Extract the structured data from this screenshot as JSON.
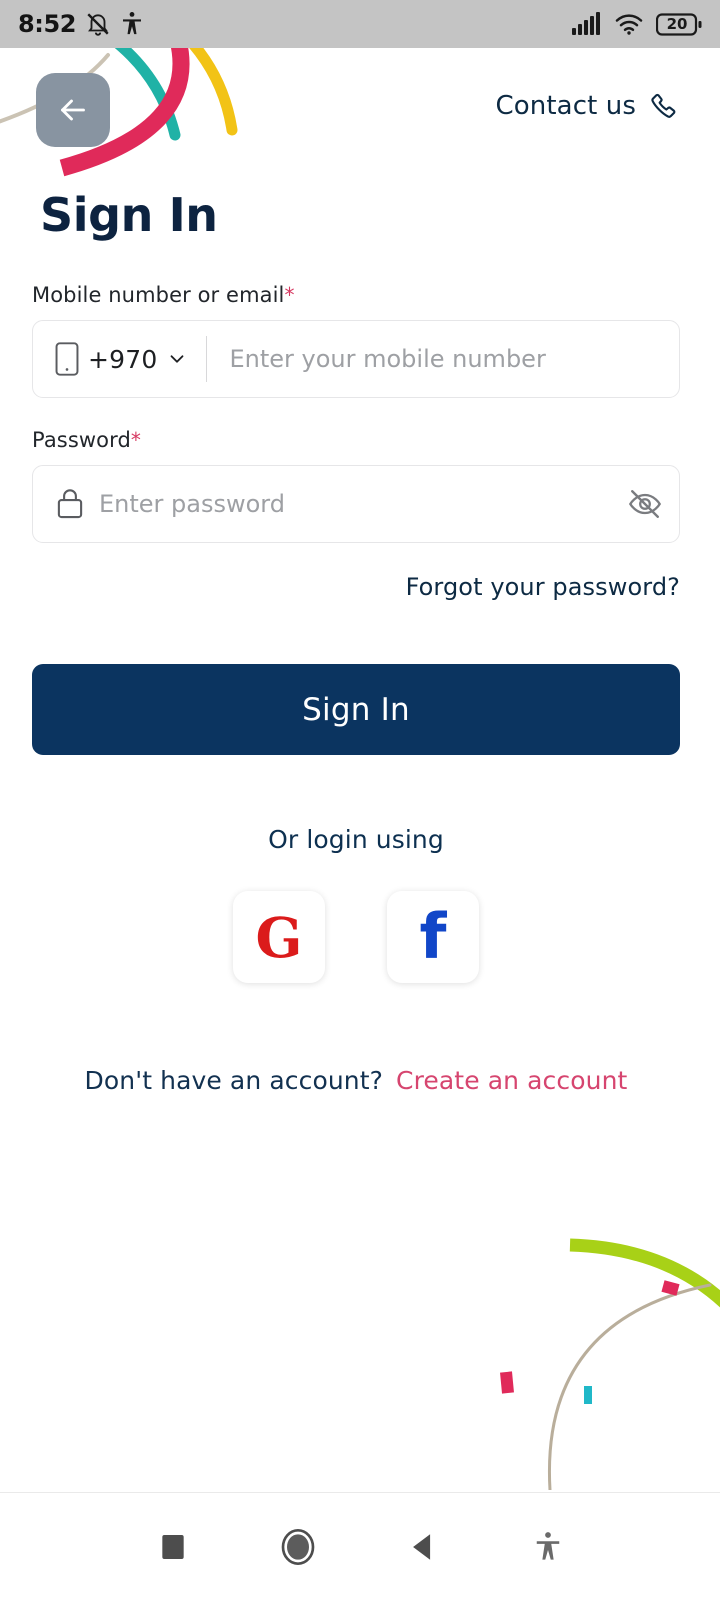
{
  "status_bar": {
    "time": "8:52",
    "battery_level": "20",
    "icons": [
      "notifications-muted-icon",
      "accessibility-icon",
      "cellular-signal-icon",
      "wifi-icon",
      "battery-icon"
    ]
  },
  "header": {
    "back_label": "back-arrow-icon",
    "contact_label": "Contact us",
    "contact_icon": "phone-icon"
  },
  "page": {
    "title": "Sign In"
  },
  "form": {
    "mobile": {
      "label": "Mobile number or email",
      "required_marker": "*",
      "country_code": "+970",
      "placeholder": "Enter your mobile number",
      "value": ""
    },
    "password": {
      "label": "Password",
      "required_marker": "*",
      "placeholder": "Enter password",
      "value": "",
      "visibility_icon": "eye-off-icon"
    },
    "forgot_password": "Forgot your password?",
    "submit_label": "Sign In"
  },
  "social": {
    "divider_text": "Or login using",
    "google_label": "G",
    "facebook_label": "f"
  },
  "signup": {
    "question": "Don't have an account?",
    "link": "Create an account"
  },
  "nav_bar": {
    "recents": "recent-apps-icon",
    "home": "home-icon",
    "back": "back-triangle-icon",
    "accessibility": "accessibility-icon"
  },
  "colors": {
    "primary_navy": "#0b3460",
    "title_navy": "#0d2340",
    "accent_pink": "#d6456f",
    "required_red": "#d63a62",
    "google_red": "#db1b1b",
    "facebook_blue": "#1146c8",
    "deco_crimson": "#e02a5a",
    "deco_teal": "#20b2a6",
    "deco_yellow": "#f2c316",
    "deco_lime": "#aad game",
    "deco_lime_hex": "#a8d117",
    "deco_tan": "#b9ae9b",
    "status_bar_bg": "#c4c4c4",
    "back_button_bg": "#8894a1",
    "input_border": "#e6e6e8",
    "placeholder_gray": "#9ea0a4"
  }
}
